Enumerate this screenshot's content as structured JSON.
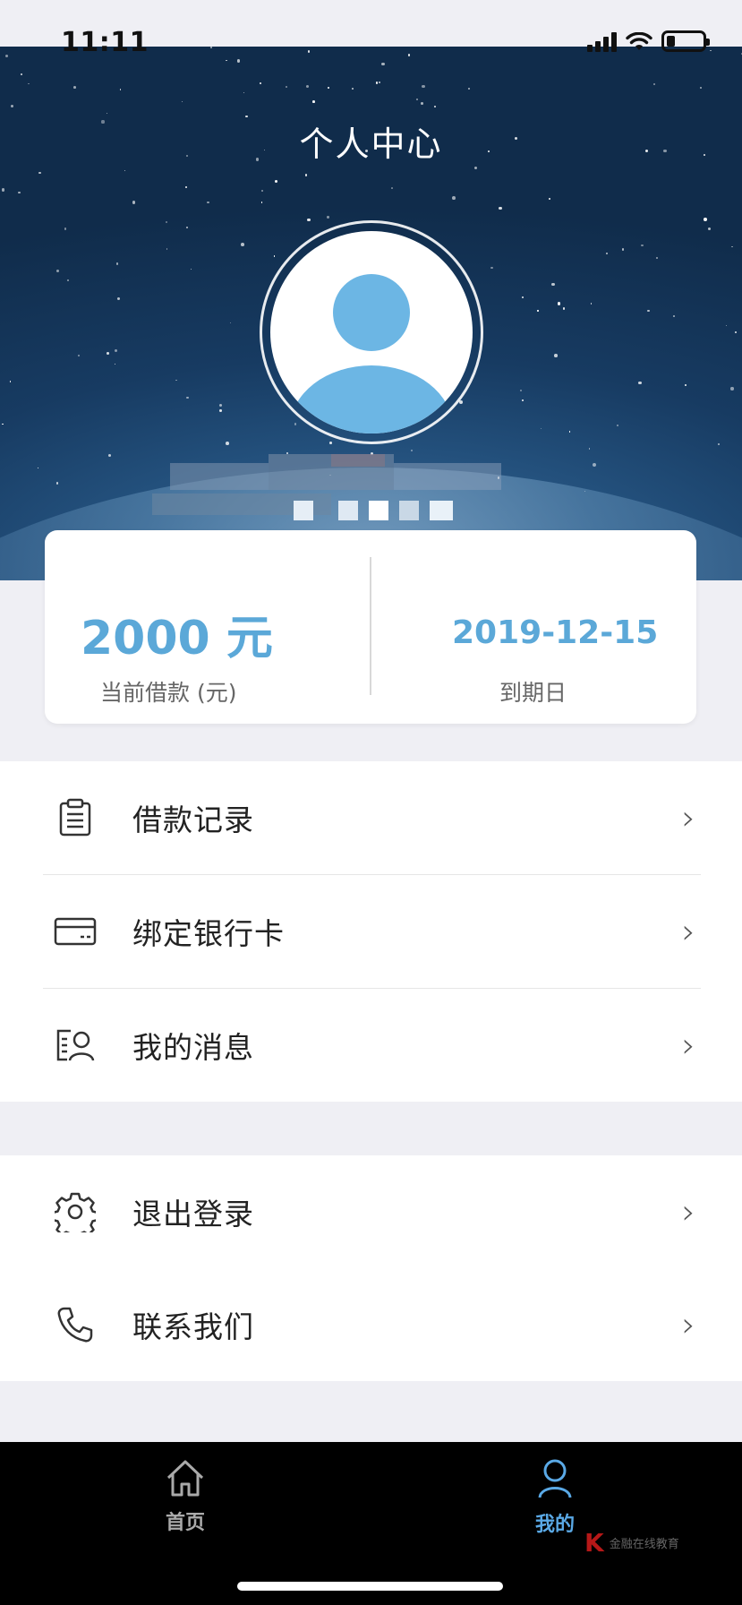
{
  "status_bar": {
    "time": "11:11"
  },
  "header": {
    "title": "个人中心"
  },
  "loan_card": {
    "amount": "2000 元",
    "amount_label": "当前借款 (元)",
    "due_date": "2019-12-15",
    "due_label": "到期日"
  },
  "menu_group1": [
    {
      "label": "借款记录",
      "icon": "clipboard-icon"
    },
    {
      "label": "绑定银行卡",
      "icon": "bank-card-icon"
    },
    {
      "label": "我的消息",
      "icon": "message-user-icon"
    }
  ],
  "menu_group2": [
    {
      "label": "退出登录",
      "icon": "gear-icon"
    },
    {
      "label": "联系我们",
      "icon": "phone-icon"
    }
  ],
  "tabbar": {
    "home_label": "首页",
    "mine_label": "我的",
    "active_color": "#5aa9e6"
  },
  "watermark": {
    "text": "金融在线教育"
  },
  "colors": {
    "accent": "#5ba8d8",
    "background": "#efeff4"
  }
}
